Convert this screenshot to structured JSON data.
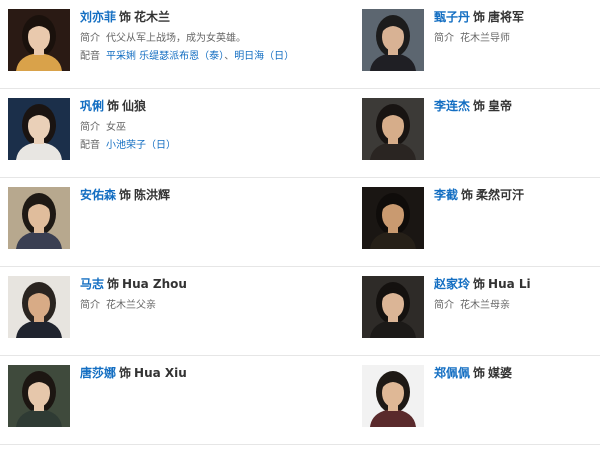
{
  "cast": [
    {
      "row": 0,
      "left": {
        "actor": "刘亦菲",
        "as": "饰",
        "role": "花木兰",
        "intro_label": "简介",
        "intro": "代父从军上战场，成为女英雄。",
        "voice_label": "配音",
        "voice1": "平采娳 乐缇瑟派布恩（泰）",
        "voice_sep": "、",
        "voice2": "明日海（日）",
        "bg": "#2a1a14",
        "skin": "#e9c9ad",
        "hair": "#1a110c",
        "cloth": "#d9a24a"
      },
      "right": {
        "actor": "甄子丹",
        "as": "饰",
        "role": "唐将军",
        "intro_label": "简介",
        "intro": "花木兰导师",
        "bg": "#5c6670",
        "skin": "#d8b294",
        "hair": "#1c1c1c",
        "cloth": "#1f1f24"
      }
    },
    {
      "row": 1,
      "left": {
        "actor": "巩俐",
        "as": "饰",
        "role": "仙狼",
        "intro_label": "简介",
        "intro": "女巫",
        "voice_label": "配音",
        "voice1": "小池荣子（日）",
        "bg": "#1b2f4a",
        "skin": "#ead0b8",
        "hair": "#1a1412",
        "cloth": "#e8e6e2"
      },
      "right": {
        "actor": "李连杰",
        "as": "饰",
        "role": "皇帝",
        "bg": "#3c3a37",
        "skin": "#d6ad8a",
        "hair": "#181412",
        "cloth": "#2a2522"
      }
    },
    {
      "row": 2,
      "left": {
        "actor": "安佑森",
        "as": "饰",
        "role": "陈洪辉",
        "bg": "#b7a88e",
        "skin": "#e0bd9c",
        "hair": "#1e1914",
        "cloth": "#3a3f52"
      },
      "right": {
        "actor": "李截",
        "as": "饰",
        "role": "柔然可汗",
        "bg": "#1a1613",
        "skin": "#c99a70",
        "hair": "#0f0c0a",
        "cloth": "#262018"
      }
    },
    {
      "row": 3,
      "left": {
        "actor": "马志",
        "as": "饰",
        "role": "Hua Zhou",
        "intro_label": "简介",
        "intro": "花木兰父亲",
        "bg": "#e7e4df",
        "skin": "#d8ab86",
        "hair": "#2a2420",
        "cloth": "#20242e"
      },
      "right": {
        "actor": "赵家玲",
        "as": "饰",
        "role": "Hua Li",
        "intro_label": "简介",
        "intro": "花木兰母亲",
        "bg": "#2e2b28",
        "skin": "#dbb596",
        "hair": "#14110f",
        "cloth": "#1c1a18"
      }
    },
    {
      "row": 4,
      "left": {
        "actor": "唐莎娜",
        "as": "饰",
        "role": "Hua Xiu",
        "bg": "#3f4a3c",
        "skin": "#e6c7ab",
        "hair": "#1c1612",
        "cloth": "#2f3b34"
      },
      "right": {
        "actor": "郑佩佩",
        "as": "饰",
        "role": "媒婆",
        "bg": "#f2f2f2",
        "skin": "#dfb896",
        "hair": "#1e1915",
        "cloth": "#5a2a2c"
      }
    }
  ]
}
